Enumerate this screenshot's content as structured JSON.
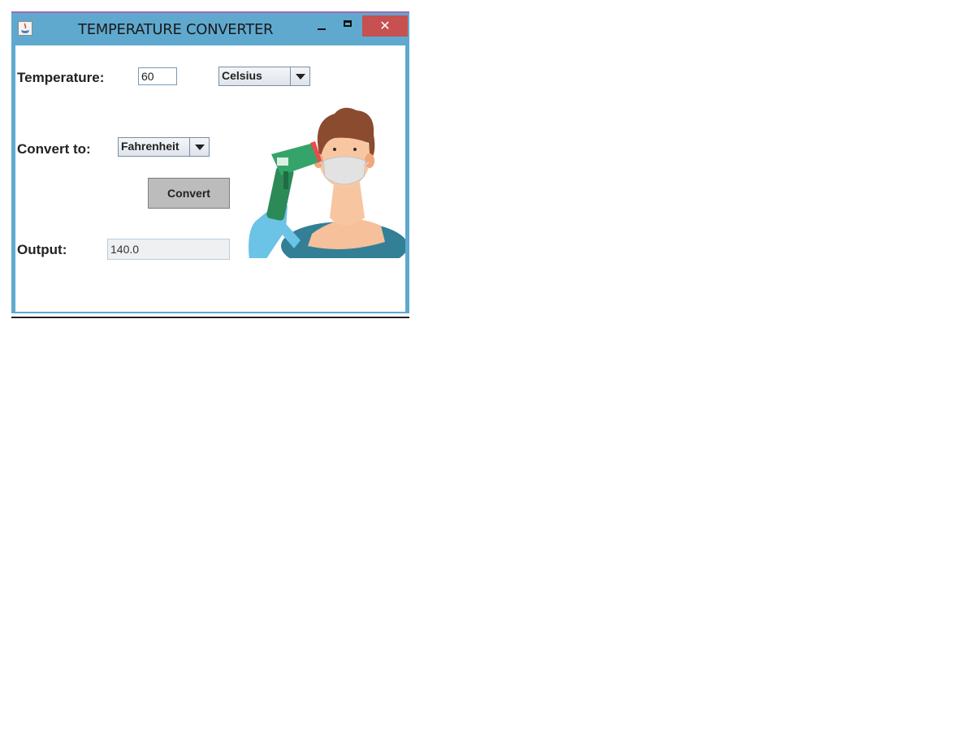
{
  "window": {
    "title": "TEMPERATURE CONVERTER",
    "close_glyph": "✕",
    "icons": [
      "java-app-icon",
      "minimize-icon",
      "maximize-icon",
      "close-icon"
    ]
  },
  "form": {
    "temperature_label": "Temperature:",
    "temperature_value": "60",
    "from_unit": "Celsius",
    "convert_to_label": "Convert to:",
    "to_unit": "Fahrenheit",
    "convert_button": "Convert",
    "output_label": "Output:",
    "output_value": "140.0"
  },
  "colors": {
    "title_bar": "#5fa9cf",
    "close_button": "#c75050",
    "convert_button": "#bcbcbc"
  }
}
